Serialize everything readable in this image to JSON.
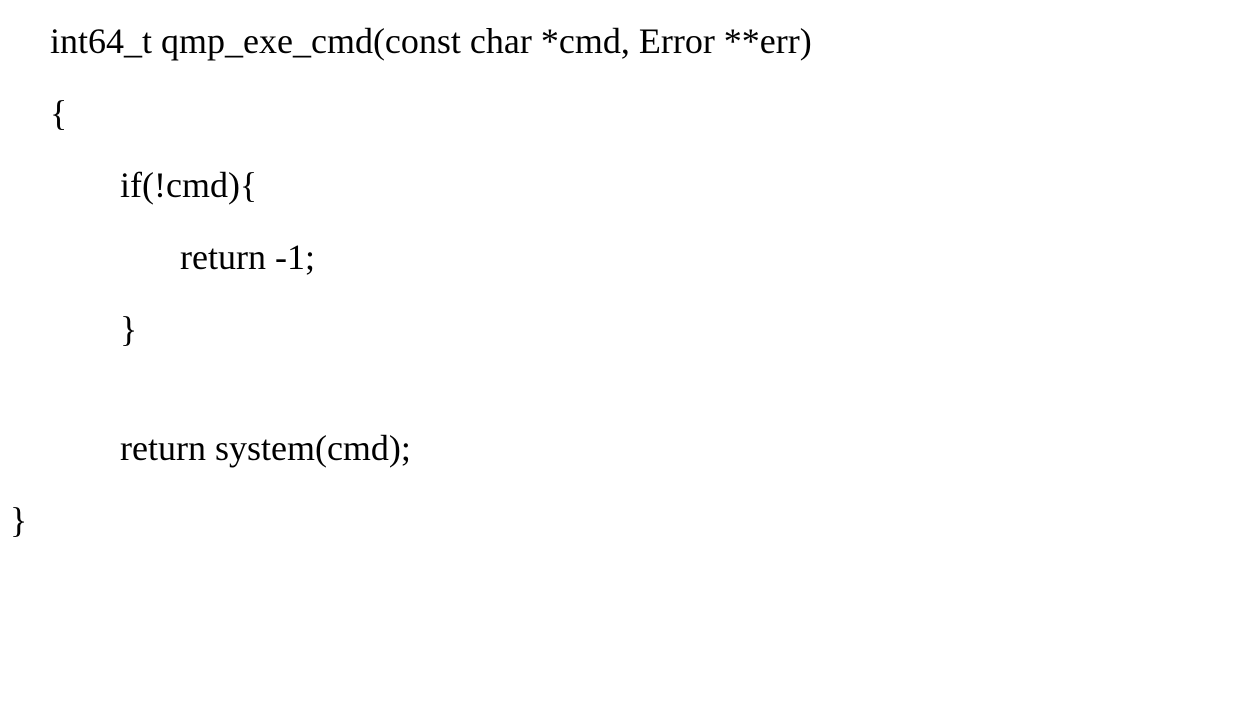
{
  "code": {
    "line1": "int64_t qmp_exe_cmd(const char *cmd, Error **err)",
    "line2": "{",
    "line3": "if(!cmd){",
    "line4": "return -1;",
    "line5": "}",
    "line6": "return system(cmd);",
    "line7": "}"
  }
}
